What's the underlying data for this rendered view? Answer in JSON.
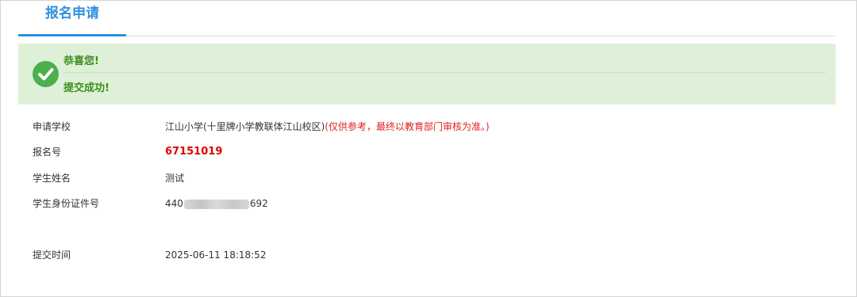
{
  "tab": {
    "label": "报名申请"
  },
  "success": {
    "line1": "恭喜您!",
    "line2": "提交成功!",
    "icon": "check-circle-icon",
    "color": "#4cae4c"
  },
  "fields": {
    "school": {
      "label": "申请学校",
      "value": "江山小学(十里牌小学教联体江山校区)",
      "note": "(仅供参考，最终以教育部门审核为准。)"
    },
    "reg_no": {
      "label": "报名号",
      "value": "67151019"
    },
    "name": {
      "label": "学生姓名",
      "value": "测试"
    },
    "id_no": {
      "label": "学生身份证件号",
      "prefix": "440",
      "suffix": "692"
    },
    "submit_time": {
      "label": "提交时间",
      "value": "2025-06-11 18:18:52"
    }
  }
}
